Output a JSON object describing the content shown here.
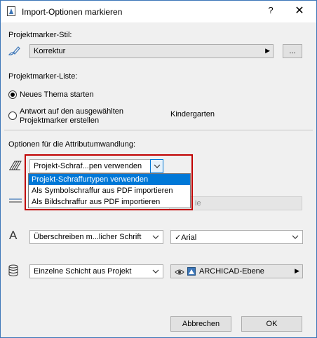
{
  "window": {
    "title": "Import-Optionen markieren",
    "help_glyph": "?",
    "close_glyph": "✕"
  },
  "marker_style": {
    "label": "Projektmarker-Stil:",
    "value": "Korrektur",
    "more_button": "..."
  },
  "marker_list": {
    "label": "Projektmarker-Liste:",
    "option1": "Neues Thema starten",
    "option2_line1": "Antwort auf den ausgewählten",
    "option2_line2": "Projektmarker erstellen",
    "option2_value": "Kindergarten",
    "selected": 0
  },
  "attr_conversion": {
    "label": "Optionen für die Attributumwandlung:",
    "hatch": {
      "value": "Projekt-Schraf...pen verwenden",
      "options": [
        "Projekt-Schraffurtypen verwenden",
        "Als Symbolschraffur aus PDF importieren",
        "Als Bildschraffur aus PDF importieren"
      ],
      "selected_index": 0
    },
    "line_partial": "ie",
    "font": {
      "mode_value": "Überschreiben m...licher Schrift",
      "font_value": "Arial",
      "font_check": "✓"
    },
    "layer": {
      "mode_value": "Einzelne Schicht aus Projekt",
      "layer_value": "ARCHICAD-Ebene"
    }
  },
  "buttons": {
    "cancel": "Abbrechen",
    "ok": "OK"
  },
  "colors": {
    "accent": "#0078d7",
    "highlight_border": "#c00000",
    "window_border": "#3c76b8"
  }
}
